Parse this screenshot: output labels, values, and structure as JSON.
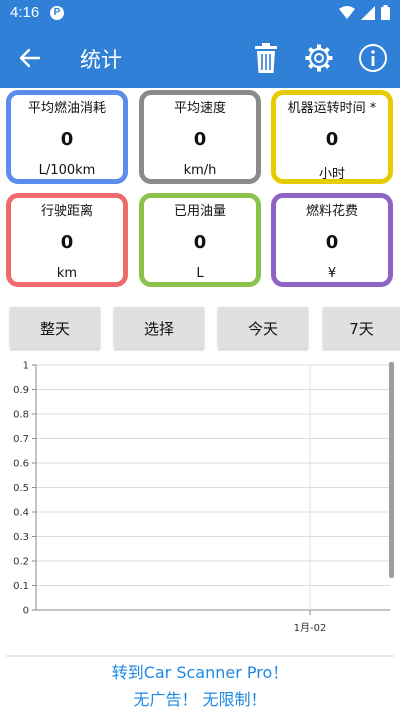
{
  "status_bar": {
    "time": "4:16",
    "notification_letter": "P"
  },
  "app_bar": {
    "title": "统计",
    "icons": [
      "back-arrow-icon",
      "trash-icon",
      "gear-icon",
      "info-icon"
    ]
  },
  "stats": [
    {
      "label": "平均燃油消耗",
      "value": "0",
      "unit": "L/100km",
      "color": "#5b8def"
    },
    {
      "label": "平均速度",
      "value": "0",
      "unit": "km/h",
      "color": "#8a8a8a"
    },
    {
      "label": "机器运转时间 *",
      "value": "0",
      "unit": "小时",
      "color": "#e6cc00"
    },
    {
      "label": "行驶距离",
      "value": "0",
      "unit": "km",
      "color": "#ef6b6b"
    },
    {
      "label": "已用油量",
      "value": "0",
      "unit": "L",
      "color": "#8bc34a"
    },
    {
      "label": "燃料花费",
      "value": "0",
      "unit": "¥",
      "color": "#8e63c6"
    }
  ],
  "periods": [
    "整天",
    "选择",
    "今天",
    "7天"
  ],
  "chart_data": {
    "type": "line",
    "x": [
      "1月-02"
    ],
    "series": [
      {
        "values": []
      }
    ],
    "ylim": [
      0,
      1
    ],
    "yticks": [
      "0",
      "0.1",
      "0.2",
      "0.3",
      "0.4",
      "0.5",
      "0.6",
      "0.7",
      "0.8",
      "0.9",
      "1"
    ],
    "xticks": [
      "1月-02"
    ],
    "grid": true
  },
  "promo": {
    "line1": "转到Car Scanner Pro！",
    "line2": "无广告！ 无限制！"
  }
}
